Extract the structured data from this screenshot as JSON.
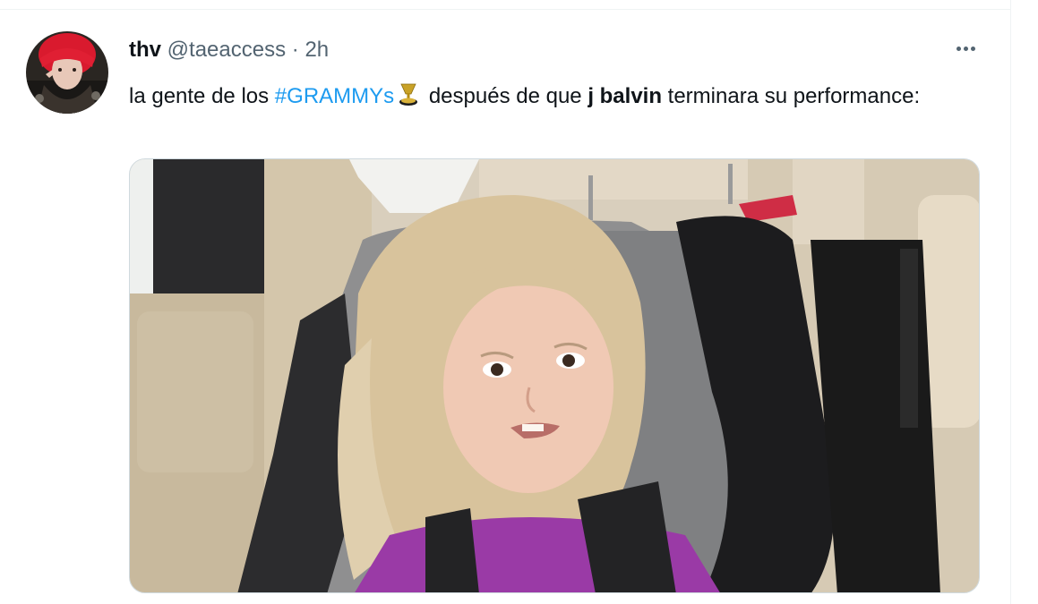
{
  "tweet": {
    "author_name": "thv",
    "handle": "@taeaccess",
    "separator": "·",
    "time": "2h",
    "text_part1": "la gente de los ",
    "hashtag": "#GRAMMYs",
    "text_part2": " después de que ",
    "bold_name": "j balvin",
    "text_part3": " terminara su performance:"
  },
  "icons": {
    "more": "more-horizontal-icon",
    "emoji": "gramophone-emoji-icon"
  },
  "colors": {
    "link": "#1d9bf0",
    "text": "#0f1419",
    "secondary": "#536471",
    "border": "#cfd9de"
  }
}
